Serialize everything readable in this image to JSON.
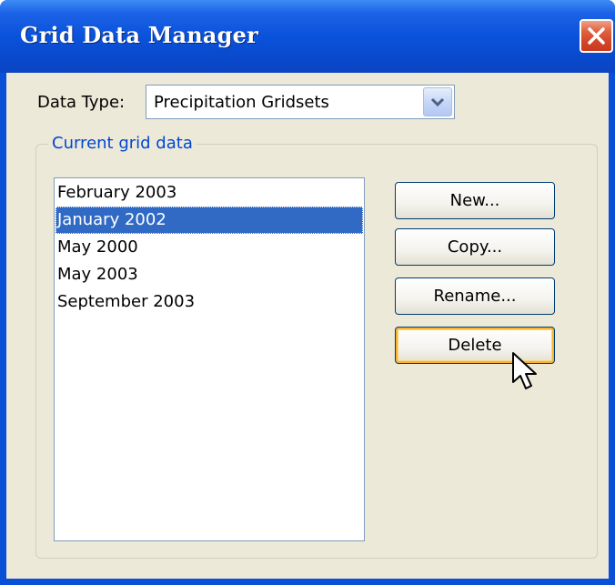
{
  "window": {
    "title": "Grid Data Manager",
    "close_icon": "close-icon"
  },
  "data_type": {
    "label": "Data Type:",
    "selected": "Precipitation Gridsets",
    "arrow_icon": "chevron-down-icon"
  },
  "group": {
    "legend": "Current grid data",
    "items": [
      {
        "label": "February 2003",
        "selected": false
      },
      {
        "label": "January 2002",
        "selected": true
      },
      {
        "label": "May 2000",
        "selected": false
      },
      {
        "label": "May 2003",
        "selected": false
      },
      {
        "label": "September 2003",
        "selected": false
      }
    ]
  },
  "buttons": {
    "new_label": "New...",
    "copy_label": "Copy...",
    "rename_label": "Rename...",
    "delete_label": "Delete"
  },
  "colors": {
    "title_bar": "#0a52db",
    "selection": "#316ac5",
    "legend_text": "#0046d5",
    "dialog_bg": "#ece9d8",
    "close_button": "#d2452a",
    "hover_highlight": "#f8b330"
  },
  "cursor": "pointer-arrow-icon"
}
